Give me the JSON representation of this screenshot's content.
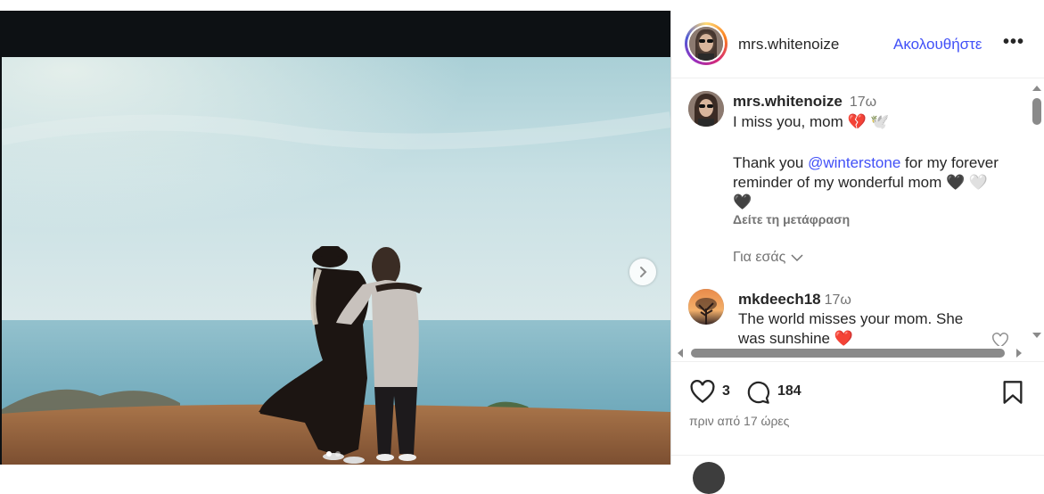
{
  "post": {
    "username": "mrs.whitenoize",
    "follow_label": "Ακολουθήστε",
    "more_label": "•••"
  },
  "caption": {
    "username": "mrs.whitenoize",
    "time": "17ω",
    "line1": "I miss you, mom 💔 🕊️",
    "thanks_prefix": "Thank you ",
    "mention": "@winterstone",
    "thanks_rest_1": " for my forever",
    "thanks_line2": "reminder of my wonderful mom 🖤 🤍",
    "thanks_line3": "🖤",
    "translate_label": "Δείτε τη μετάφραση",
    "for_you_label": "Για εσάς"
  },
  "comments": [
    {
      "username": "mkdeech18",
      "time": "17ω",
      "line1": "The world misses your mom. She",
      "line2": "was sunshine ❤️"
    }
  ],
  "actions": {
    "likes": "3",
    "comments_count": "184",
    "posted_time": "πριν από 17 ώρες"
  },
  "carousel": {
    "total_slides": 2,
    "active_index": 0
  },
  "icons": {
    "next": "chevron-right-icon",
    "like": "heart-icon",
    "comment": "comment-icon",
    "save": "bookmark-icon",
    "expand": "chevron-down-icon"
  },
  "colors": {
    "accent": "#4150f7",
    "text": "#262626",
    "muted": "#737373"
  }
}
